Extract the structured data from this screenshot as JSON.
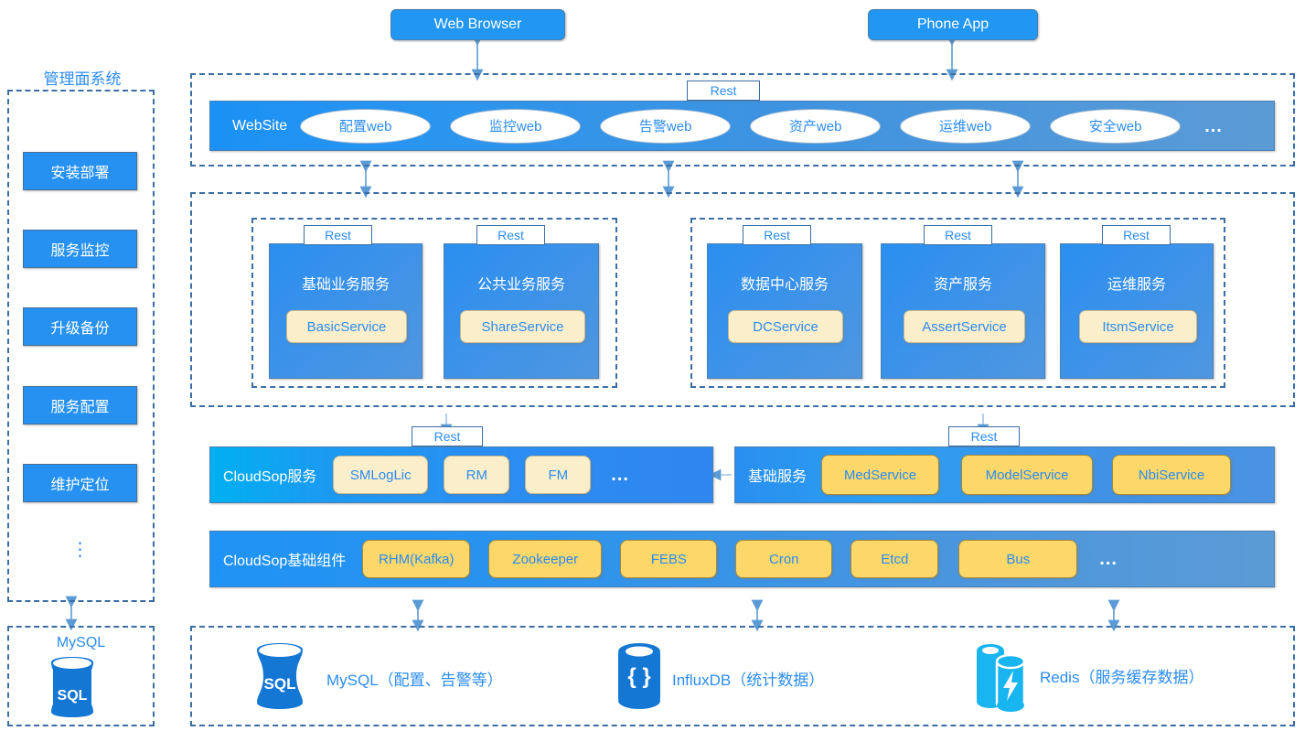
{
  "clients": [
    {
      "label": "Web Browser",
      "name": "web-browser-box"
    },
    {
      "label": "Phone App",
      "name": "phone-app-box"
    }
  ],
  "rest_label": "Rest",
  "ellipsis": "...",
  "management": {
    "title": "管理面系统",
    "items": [
      {
        "label": "安装部署"
      },
      {
        "label": "服务监控"
      },
      {
        "label": "升级备份"
      },
      {
        "label": "服务配置"
      },
      {
        "label": "维护定位"
      }
    ],
    "more": "⋮",
    "db": {
      "title": "MySQL",
      "icon": "sql-cylinder-icon",
      "icon_text": "SQL"
    }
  },
  "website_layer": {
    "label": "WebSite",
    "nodes": [
      {
        "label": "配置web"
      },
      {
        "label": "监控web"
      },
      {
        "label": "告警web"
      },
      {
        "label": "资产web"
      },
      {
        "label": "运维web"
      },
      {
        "label": "安全web"
      }
    ],
    "more": "..."
  },
  "service_layer": {
    "left_group": [
      {
        "title": "基础业务服务",
        "pill": "BasicService",
        "rest": "Rest"
      },
      {
        "title": "公共业务服务",
        "pill": "ShareService",
        "rest": "Rest"
      }
    ],
    "right_group": [
      {
        "title": "数据中心服务",
        "pill": "DCService",
        "rest": "Rest"
      },
      {
        "title": "资产服务",
        "pill": "AssertService",
        "rest": "Rest"
      },
      {
        "title": "运维服务",
        "pill": "ItsmService",
        "rest": "Rest"
      }
    ]
  },
  "cloudsop_layer": {
    "label": "CloudSop服务",
    "rest": "Rest",
    "pills": [
      "SMLogLic",
      "RM",
      "FM"
    ],
    "more": "..."
  },
  "basic_layer": {
    "label": "基础服务",
    "rest": "Rest",
    "pills": [
      "MedService",
      "ModelService",
      "NbiService"
    ]
  },
  "components_layer": {
    "label": "CloudSop基础组件",
    "pills": [
      "RHM(Kafka)",
      "Zookeeper",
      "FEBS",
      "Cron",
      "Etcd",
      "Bus"
    ],
    "more": "..."
  },
  "database_layer": {
    "items": [
      {
        "label": "MySQL（配置、告警等）",
        "icon": "sql-cylinder-icon",
        "icon_text": "SQL",
        "color": "#1577d4"
      },
      {
        "label": "InfluxDB（统计数据）",
        "icon": "influxdb-cylinder-icon",
        "icon_text": "{ }",
        "color": "#1577d4"
      },
      {
        "label": "Redis（服务缓存数据）",
        "icon": "redis-bolt-icon",
        "icon_text": "⚡",
        "color": "#19b5f0"
      }
    ]
  },
  "colors": {
    "accent_blue": "#2b8cf0",
    "dash_border": "#3a6ea5",
    "card_blue": "#2a8ff0",
    "pill_cream": "#fbeecb",
    "pill_yellow": "#fcd769",
    "white": "#ffffff"
  }
}
